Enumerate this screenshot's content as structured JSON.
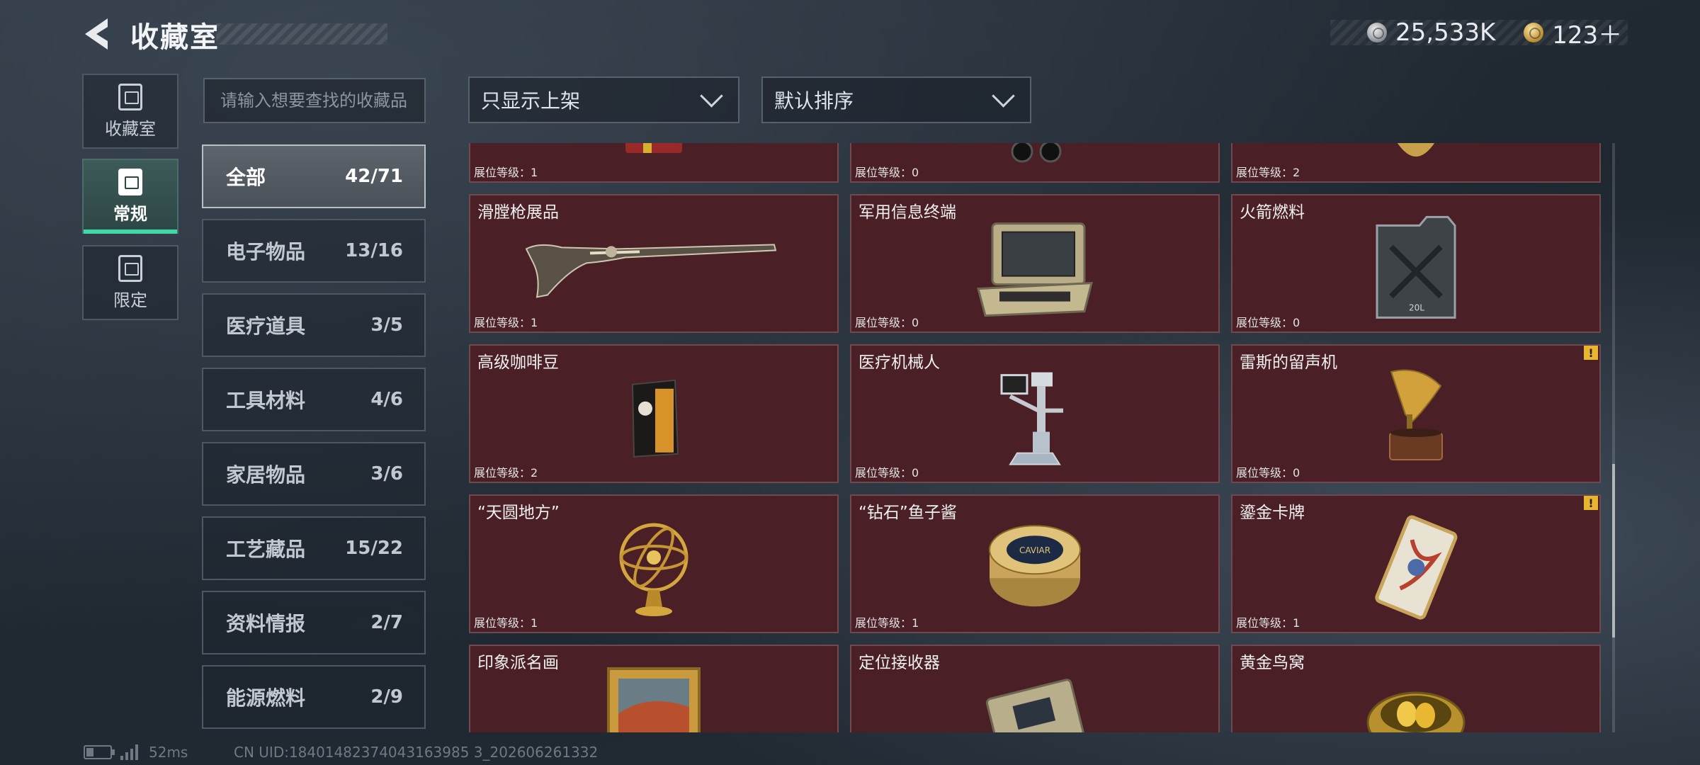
{
  "header": {
    "title": "收藏室",
    "currency_silver": "25,533K",
    "currency_gold": "123＋"
  },
  "nav": {
    "tabs": [
      {
        "label": "收藏室",
        "icon": "trash-bin-icon"
      },
      {
        "label": "常规",
        "icon": "gallery-icon",
        "active": true
      },
      {
        "label": "限定",
        "icon": "image-frame-icon"
      }
    ]
  },
  "search": {
    "placeholder": "请输入想要查找的收藏品"
  },
  "filters": {
    "display": "只显示上架",
    "sort": "默认排序"
  },
  "categories": [
    {
      "name": "全部",
      "count": "42/71",
      "active": true
    },
    {
      "name": "电子物品",
      "count": "13/16"
    },
    {
      "name": "医疗道具",
      "count": "3/5"
    },
    {
      "name": "工具材料",
      "count": "4/6"
    },
    {
      "name": "家居物品",
      "count": "3/6"
    },
    {
      "name": "工艺藏品",
      "count": "15/22"
    },
    {
      "name": "资料情报",
      "count": "2/7"
    },
    {
      "name": "能源燃料",
      "count": "2/9"
    }
  ],
  "items": [
    {
      "name": "",
      "level": "展位等级：1",
      "icon": "dynamite-icon"
    },
    {
      "name": "",
      "level": "展位等级：0",
      "icon": "binoculars-icon"
    },
    {
      "name": "",
      "level": "展位等级：2",
      "icon": "gold-ornament-icon"
    },
    {
      "name": "滑膛枪展品",
      "level": "展位等级：1",
      "icon": "musket-icon"
    },
    {
      "name": "军用信息终端",
      "level": "展位等级：0",
      "icon": "rugged-laptop-icon"
    },
    {
      "name": "火箭燃料",
      "level": "展位等级：0",
      "icon": "fuel-jerrycan-icon"
    },
    {
      "name": "高级咖啡豆",
      "level": "展位等级：2",
      "icon": "coffee-bag-icon"
    },
    {
      "name": "医疗机械人",
      "level": "展位等级：0",
      "icon": "medical-robot-icon"
    },
    {
      "name": "雷斯的留声机",
      "level": "展位等级：0",
      "icon": "gramophone-icon",
      "warning": true
    },
    {
      "name": "“天圆地方”",
      "level": "展位等级：1",
      "icon": "armillary-sphere-icon"
    },
    {
      "name": "“钻石”鱼子酱",
      "level": "展位等级：1",
      "icon": "caviar-tin-icon"
    },
    {
      "name": "鎏金卡牌",
      "level": "展位等级：1",
      "icon": "gilded-card-icon",
      "warning": true
    },
    {
      "name": "印象派名画",
      "level": "",
      "icon": "framed-painting-icon"
    },
    {
      "name": "定位接收器",
      "level": "",
      "icon": "gps-receiver-icon"
    },
    {
      "name": "黄金鸟窝",
      "level": "",
      "icon": "golden-nest-icon"
    }
  ],
  "caviar_label": "CAVIAR",
  "fuel_label": "20L",
  "warning_mark": "!",
  "status": {
    "ping": "52ms",
    "uid": "CN UID:18401482374043163985 3_202606261332"
  },
  "colors": {
    "card_bg": "#4a1f26",
    "accent": "#3fd8a6",
    "warning": "#e8b530"
  }
}
